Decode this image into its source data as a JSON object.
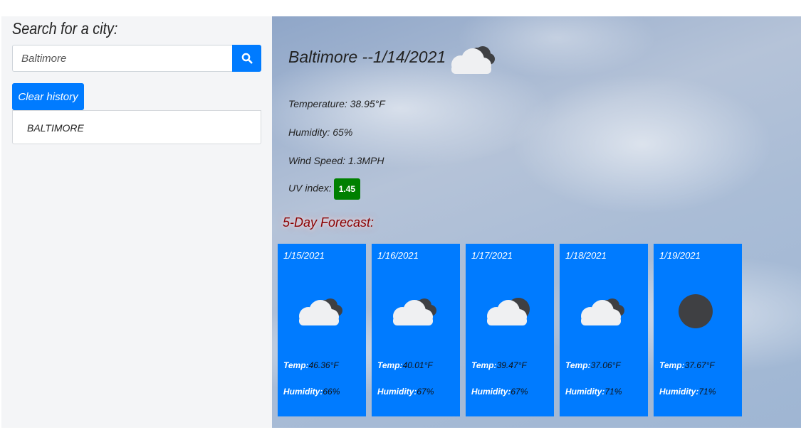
{
  "sidebar": {
    "heading": "Search for a city:",
    "search": {
      "value": "Baltimore",
      "placeholder": ""
    },
    "search_button_icon": "search-icon",
    "clear_label": "Clear history",
    "history": [
      "BALTIMORE"
    ]
  },
  "current": {
    "title": "Baltimore --1/14/2021",
    "icon": "partly-cloudy-icon",
    "temperature_label": "Temperature:",
    "temperature_value": "38.95°F",
    "humidity_label": "Humidity:",
    "humidity_value": "65%",
    "wind_label": "Wind Speed:",
    "wind_value": "1.3MPH",
    "uv_label": "UV index:",
    "uv_value": "1.45",
    "uv_color": "#008000"
  },
  "forecast": {
    "heading": "5-Day Forecast:",
    "temp_label": "Temp:",
    "humidity_label": "Humidity:",
    "card_color": "#007bff",
    "days": [
      {
        "date": "1/15/2021",
        "icon": "cloudy-icon",
        "temp": "46.36°F",
        "humidity": "66%"
      },
      {
        "date": "1/16/2021",
        "icon": "cloudy-icon",
        "temp": "40.01°F",
        "humidity": "67%"
      },
      {
        "date": "1/17/2021",
        "icon": "partly-cloudy-icon",
        "temp": "39.47°F",
        "humidity": "67%"
      },
      {
        "date": "1/18/2021",
        "icon": "cloudy-icon",
        "temp": "37.06°F",
        "humidity": "71%"
      },
      {
        "date": "1/19/2021",
        "icon": "overcast-icon",
        "temp": "37.67°F",
        "humidity": "71%"
      }
    ]
  }
}
